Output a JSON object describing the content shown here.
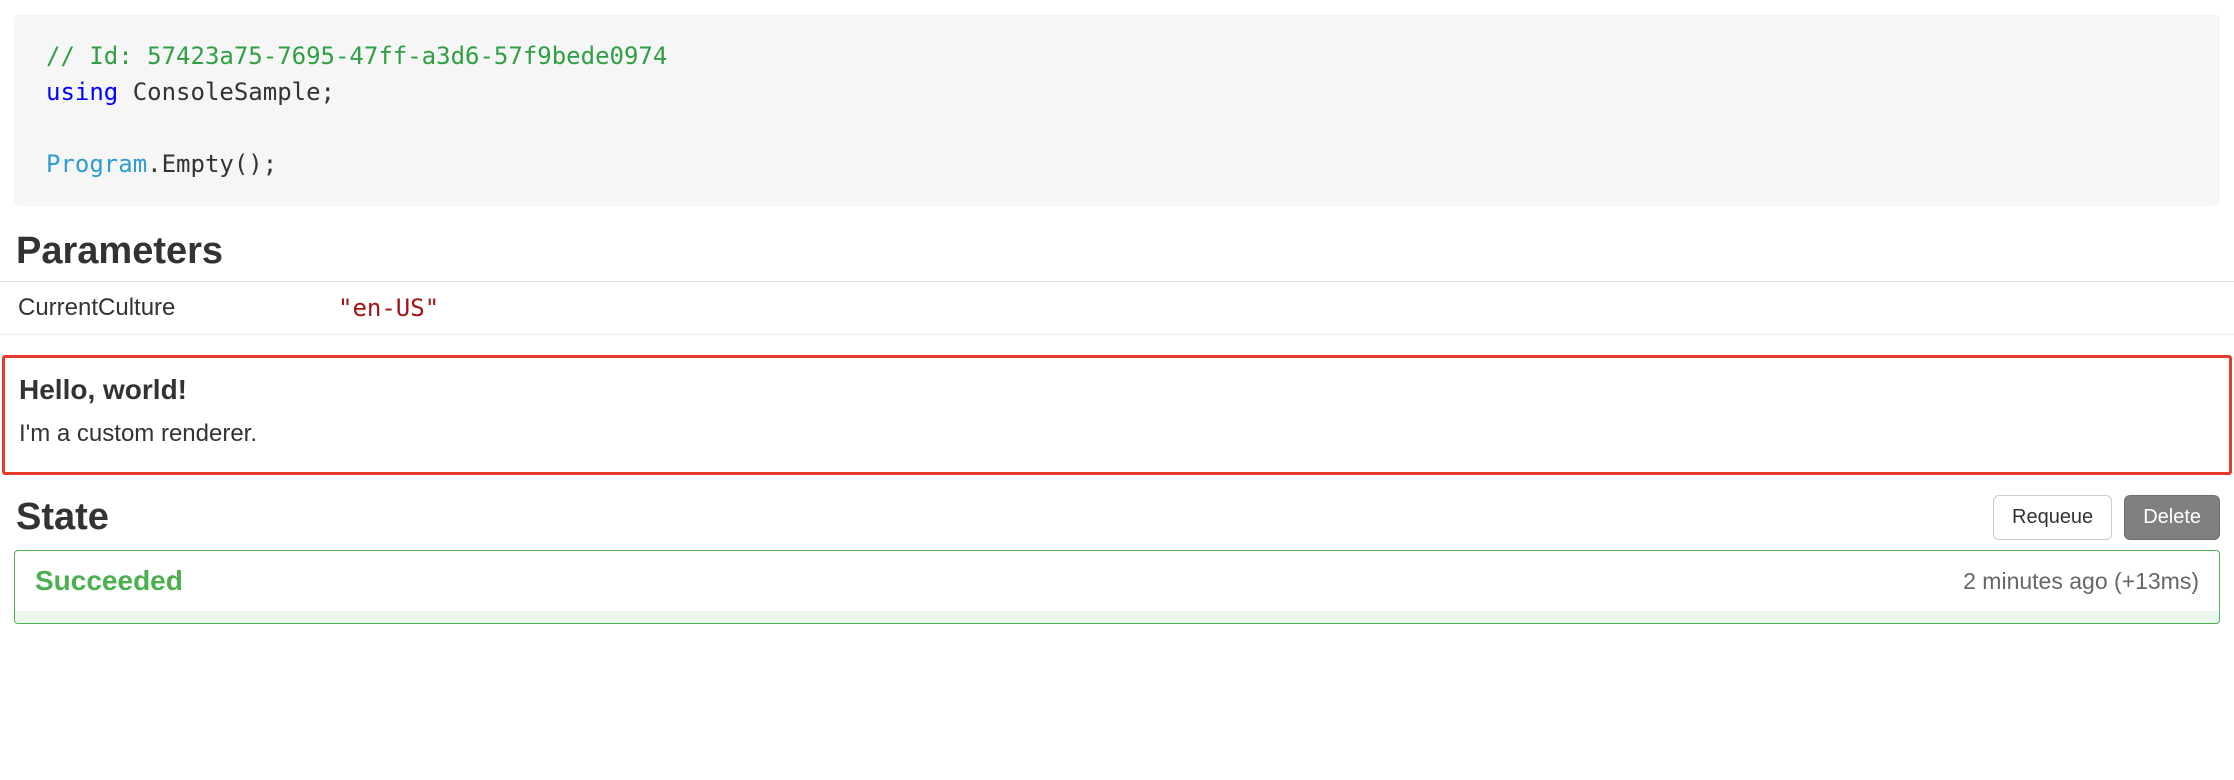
{
  "code": {
    "comment": "// Id: 57423a75-7695-47ff-a3d6-57f9bede0974",
    "keyword": "using",
    "namespace": " ConsoleSample;",
    "class": "Program",
    "call": ".Empty();"
  },
  "parameters": {
    "heading": "Parameters",
    "rows": [
      {
        "name": "CurrentCulture",
        "value": "\"en-US\""
      }
    ]
  },
  "custom": {
    "title": "Hello, world!",
    "text": "I'm a custom renderer."
  },
  "state": {
    "heading": "State",
    "buttons": {
      "requeue": "Requeue",
      "delete": "Delete"
    },
    "status": "Succeeded",
    "time": "2 minutes ago (+13ms)"
  }
}
